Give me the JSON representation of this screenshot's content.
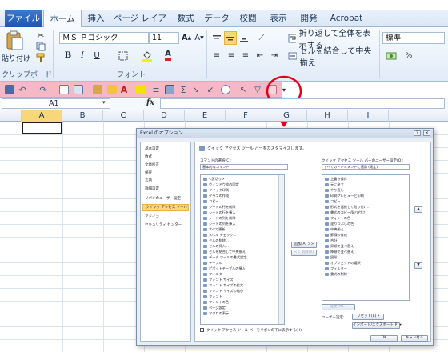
{
  "tabs": [
    "ファイル",
    "ホーム",
    "挿入",
    "ページ レイアウト",
    "数式",
    "データ",
    "校閲",
    "表示",
    "開発",
    "Acrobat"
  ],
  "ribbon": {
    "paste_label": "貼り付け",
    "clipboard_label": "クリップボード",
    "font_group_label": "フォント",
    "font_name": "ＭＳ Ｐゴシック",
    "font_size": "11",
    "wrap_text": "折り返して全体を表示する",
    "merge_center": "セルを結合して中央揃え",
    "number_format": "標準"
  },
  "formula_bar": {
    "cell_ref": "A1",
    "fx": "fx"
  },
  "columns": [
    "A",
    "B",
    "C",
    "D",
    "E",
    "F",
    "G",
    "H",
    "I"
  ],
  "dialog": {
    "title": "Excel のオプション",
    "nav": [
      "基本設定",
      "数式",
      "文章校正",
      "保存",
      "言語",
      "詳細設定",
      "リボンのユーザー設定",
      "クイック アクセス ツール バー",
      "アドイン",
      "セキュリティ センター"
    ],
    "heading": "クイック アクセス ツール バーをカスタマイズします。",
    "choose_label": "コマンドの選択(C):",
    "choose_value": "基本的なコマンド",
    "customize_label": "クイック アクセス ツール バーのユーザー設定(Q):",
    "customize_value": "すべてのドキュメントに適用 (既定)",
    "left_items": [
      "<区切り>",
      "ウィンドウ枠の固定",
      "クイック印刷",
      "グラフの作成",
      "コピー",
      "シートの行を削除",
      "シートの行を挿入",
      "シートの列を削除",
      "シートの列を挿入",
      "すべて更新",
      "スペル チェック...",
      "セルの削除...",
      "セルの挿入...",
      "セルを結合して中央揃え",
      "データ ツールの書式設定",
      "テーブル",
      "ピボットテーブルの挿入",
      "フィルター",
      "フォント サイズ",
      "フォント サイズの拡大",
      "フォント サイズの縮小",
      "フォント",
      "フォントの色",
      "ページ設定",
      "マクロの表示"
    ],
    "right_items": [
      "上書き保存",
      "元に戻す",
      "やり直し",
      "印刷プレビューと印刷",
      "コピー",
      "形式を選択して貼り付け...",
      "書式のコピー/貼り付け",
      "フォントの色",
      "塗りつぶしの色",
      "中央揃え",
      "罫線の作成",
      "合計",
      "昇順で並べ替え",
      "降順で並べ替え",
      "図形",
      "オブジェクトの選択",
      "フィルター",
      "書式の削除"
    ],
    "add_btn": "追加(A) >>",
    "remove_btn": "<< 削除(R)",
    "modify_btn": "変更(M)...",
    "user_settings_label": "ユーザー設定:",
    "reset_btn": "リセット(E) ▾",
    "import_btn": "インポート/エクスポート(P) ▾",
    "checkbox_label": "クイック アクセス ツール バーをリボンの下に表示する(H)",
    "ok_btn": "OK",
    "cancel_btn": "キャンセル"
  },
  "colors": {
    "qat_highlight": "#f4b9c4",
    "circle": "#e3001b",
    "selected_cell": "#fbd874",
    "file_tab": "#2a63c0"
  }
}
